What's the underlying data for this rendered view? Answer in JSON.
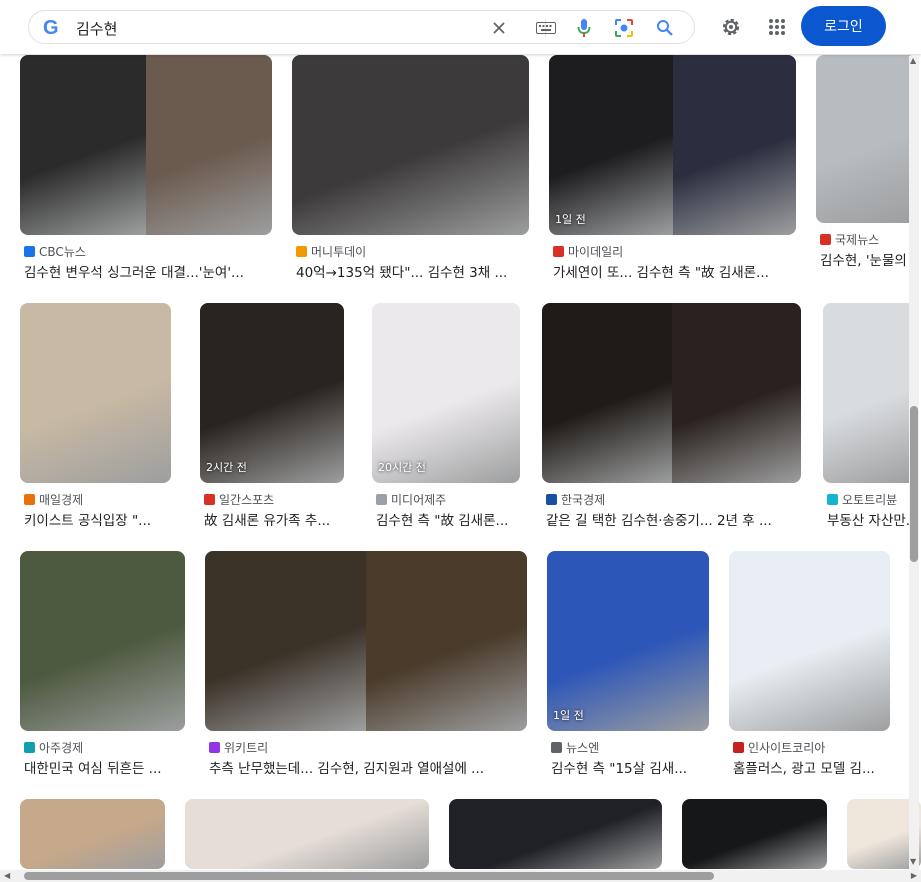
{
  "header": {
    "search_query": "김수현",
    "google_logo": "G",
    "login_label": "로그인",
    "icons": {
      "clear": "close-icon",
      "keyboard": "keyboard-icon",
      "voice": "microphone-icon",
      "lens": "camera-lens-icon",
      "search": "search-icon",
      "settings": "gear-icon",
      "apps": "apps-grid-icon"
    },
    "colors": {
      "login_button": "#0b57d0",
      "logo_blue": "#4285f4",
      "mic_blue": "#4285f4",
      "mic_red": "#ea4335"
    }
  },
  "results": [
    {
      "source": "CBC뉴스",
      "title": "김수현 변우석 싱그러운 대결...'눈여'...",
      "badge": "",
      "fav_color": "#1a73e8"
    },
    {
      "source": "머니투데이",
      "title": "40억→135억 됐다\"... 김수현 3채 ...",
      "badge": "",
      "fav_color": "#f29900"
    },
    {
      "source": "마이데일리",
      "title": "가세연이 또... 김수현 측 \"故 김새론...",
      "badge": "1일 전",
      "fav_color": "#d93025"
    },
    {
      "source": "국제뉴스",
      "title": "김수현, '눈물의 여왕'...",
      "badge": "",
      "fav_color": "#d93025"
    },
    {
      "source": "매일경제",
      "title": "키이스트 공식입장 \"...",
      "badge": "",
      "fav_color": "#e8710a"
    },
    {
      "source": "일간스포츠",
      "title": "故 김새론 유가족 추...",
      "badge": "2시간 전",
      "fav_color": "#d93025"
    },
    {
      "source": "미디어제주",
      "title": "김수현 측 \"故 김새론...",
      "badge": "20시간 전",
      "fav_color": "#9aa0a6"
    },
    {
      "source": "한국경제",
      "title": "같은 길 택한 김수현·송중기... 2년 후 ...",
      "badge": "",
      "fav_color": "#174ea6"
    },
    {
      "source": "오토트리뷴",
      "title": "부동산 자산만...",
      "badge": "",
      "fav_color": "#12b5cb"
    },
    {
      "source": "아주경제",
      "title": "대한민국 여심 뒤흔든 ...",
      "badge": "",
      "fav_color": "#129eaf"
    },
    {
      "source": "위키트리",
      "title": "추측 난무했는데... 김수현, 김지원과 열애설에 ...",
      "badge": "",
      "fav_color": "#9334e6"
    },
    {
      "source": "뉴스엔",
      "title": "김수현 측 \"15살 김새...",
      "badge": "1일 전",
      "fav_color": "#5f6368"
    },
    {
      "source": "인사이트코리아",
      "title": "홈플러스, 광고 모델 김...",
      "badge": "",
      "fav_color": "#c5221f"
    },
    {
      "source": "",
      "title": "",
      "badge": "",
      "fav_color": ""
    },
    {
      "source": "",
      "title": "",
      "badge": "",
      "fav_color": ""
    },
    {
      "source": "",
      "title": "",
      "badge": "",
      "fav_color": ""
    },
    {
      "source": "",
      "title": "",
      "badge": "",
      "fav_color": ""
    },
    {
      "source": "",
      "title": "",
      "badge": "",
      "fav_color": ""
    }
  ]
}
